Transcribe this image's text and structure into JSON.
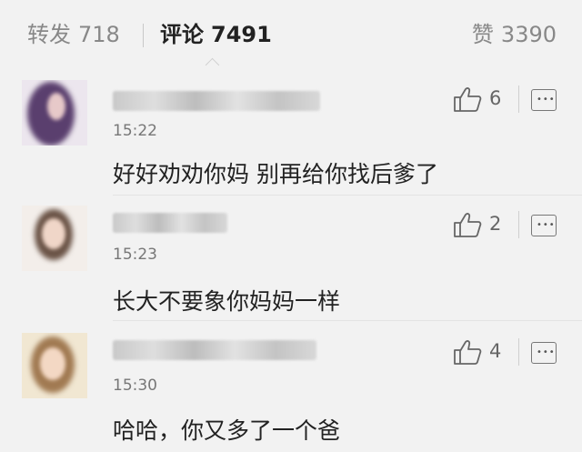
{
  "tabs": {
    "repost": {
      "label": "转发",
      "count": "718"
    },
    "comments": {
      "label": "评论",
      "count": "7491"
    },
    "likes": {
      "label": "赞",
      "count": "3390"
    }
  },
  "comments": [
    {
      "time": "15:22",
      "text": "好好劝劝你妈 别再给你找后爹了",
      "likes": "6"
    },
    {
      "time": "15:23",
      "text": "长大不要象你妈妈一样",
      "likes": "2"
    },
    {
      "time": "15:30",
      "text": "哈哈，你又多了一个爸",
      "likes": "4"
    }
  ],
  "colors": {
    "background": "#f2f2f2",
    "primary_text": "#222222",
    "secondary_text": "#888888"
  }
}
